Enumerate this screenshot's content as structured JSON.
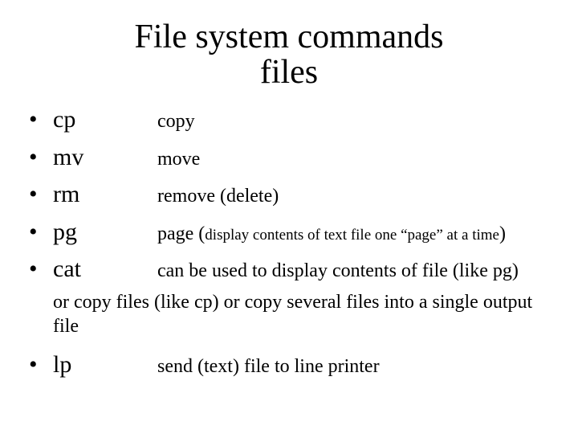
{
  "title_line1": "File system commands",
  "title_line2": "files",
  "bullet": "•",
  "items": {
    "cp": {
      "cmd": "cp",
      "desc": "copy"
    },
    "mv": {
      "cmd": "mv",
      "desc": "move"
    },
    "rm": {
      "cmd": "rm",
      "desc": "remove (delete)"
    },
    "pg": {
      "cmd": "pg",
      "desc_pre": "page (",
      "desc_paren": "display contents of text file one “page” at a time",
      "desc_post": ")"
    },
    "cat": {
      "cmd": "cat",
      "desc": "can be used to display contents of file (like pg)"
    },
    "lp": {
      "cmd": "lp",
      "desc": "send (text) file to line printer"
    }
  },
  "cat_continuation": "or copy files (like cp) or copy several files into a single output file"
}
